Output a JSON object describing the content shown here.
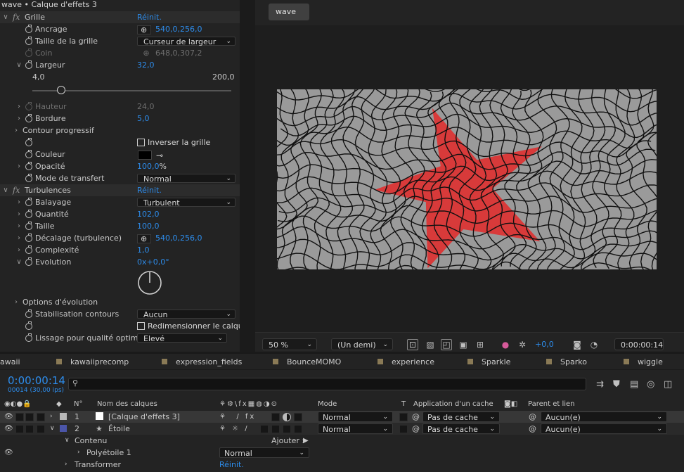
{
  "effect_controls": {
    "title": "wave • Calque d'effets 3",
    "grille": {
      "label": "Grille",
      "reset": "Réinit."
    },
    "ancrage": {
      "label": "Ancrage",
      "value": "540,0,256,0"
    },
    "taille_grille": {
      "label": "Taille de la grille",
      "value": "Curseur de largeur"
    },
    "coin": {
      "label": "Coin",
      "value": "648,0,307,2"
    },
    "largeur": {
      "label": "Largeur",
      "value": "32,0",
      "min": "4,0",
      "max": "200,0",
      "slider_fraction": 0.145
    },
    "hauteur": {
      "label": "Hauteur",
      "value": "24,0"
    },
    "bordure": {
      "label": "Bordure",
      "value": "5,0"
    },
    "contour": {
      "label": "Contour progressif"
    },
    "inverser": {
      "label": "Inverser la grille"
    },
    "couleur": {
      "label": "Couleur"
    },
    "opacite": {
      "label": "Opacité",
      "value": "100,0",
      "unit": "%"
    },
    "mode_transfert": {
      "label": "Mode de transfert",
      "value": "Normal"
    },
    "turbulences": {
      "label": "Turbulences",
      "reset": "Réinit."
    },
    "balayage": {
      "label": "Balayage",
      "value": "Turbulent"
    },
    "quantite": {
      "label": "Quantité",
      "value": "102,0"
    },
    "taille": {
      "label": "Taille",
      "value": "100,0"
    },
    "decalage": {
      "label": "Décalage (turbulence)",
      "value": "540,0,256,0"
    },
    "complexite": {
      "label": "Complexité",
      "value": "1,0"
    },
    "evolution": {
      "label": "Evolution",
      "value": "0x+0,0°"
    },
    "options_evolution": {
      "label": "Options d'évolution"
    },
    "stabilisation": {
      "label": "Stabilisation contours",
      "value": "Aucun"
    },
    "redimensionner": {
      "label": "Redimensionner le calqu"
    },
    "lissage": {
      "label": "Lissage pour qualité optimal",
      "value": "Elevé"
    }
  },
  "viewer": {
    "tab": "wave",
    "zoom": "50 %",
    "resolution": "(Un demi)",
    "exposure": "+0,0",
    "timecode": "0:00:00:14",
    "colors": {
      "background": "#9a9a9a",
      "star": "#d83a3a",
      "grid": "#111111"
    }
  },
  "timeline": {
    "tabs": [
      "awaii",
      "kawaiiprecomp",
      "expression_fields",
      "BounceMOMO",
      "experience",
      "Sparkle",
      "Sparko",
      "wiggle"
    ],
    "timecode": "0:00:00:14",
    "frames": "00014 (30,00 ips)",
    "columns": {
      "num": "N°",
      "name": "Nom des calques",
      "mode": "Mode",
      "t": "T",
      "cache": "Application d'un cache",
      "parent": "Parent et lien"
    },
    "layers": [
      {
        "num": "1",
        "name": "[Calque d'effets 3]",
        "mode": "Normal",
        "cache": "Pas de cache",
        "parent": "Aucun(e)",
        "color": "#b8b8b8"
      },
      {
        "num": "2",
        "name": "Étoile",
        "mode": "Normal",
        "cache": "Pas de cache",
        "parent": "Aucun(e)",
        "color": "#4b55a8"
      }
    ],
    "contenu": "Contenu",
    "ajouter": "Ajouter :",
    "polyetoile": "Polyétoile 1",
    "polyetoile_mode": "Normal",
    "transformer": "Transformer",
    "transformer_reset": "Réinit."
  }
}
